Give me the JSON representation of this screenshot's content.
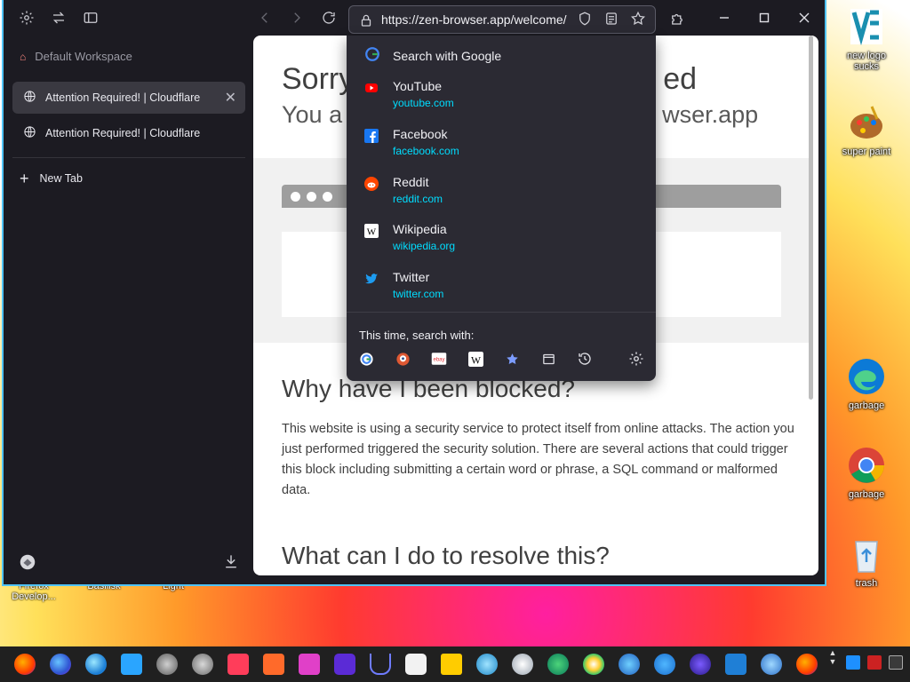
{
  "browser": {
    "url": "https://zen-browser.app/welcome/",
    "workspace": "Default Workspace",
    "tabs": [
      {
        "label": "Attention Required! | Cloudflare",
        "active": true
      },
      {
        "label": "Attention Required! | Cloudflare",
        "active": false
      }
    ],
    "new_tab": "New Tab"
  },
  "page": {
    "h1_partial": "Sorry",
    "h1_tail": "ed",
    "h1b_partial": "You a",
    "h1b_tail": "wser.app",
    "h2": "Why have I been blocked?",
    "para": "This website is using a security service to protect itself from online attacks. The action you just performed triggered the security solution. There are several actions that could trigger this block including submitting a certain word or phrase, a SQL command or malformed data.",
    "h2b": "What can I do to resolve this?"
  },
  "dropdown": {
    "search_with": "Search with Google",
    "suggestions": [
      {
        "title": "YouTube",
        "url": "youtube.com",
        "icon": "youtube-icon",
        "color": "#ff0000"
      },
      {
        "title": "Facebook",
        "url": "facebook.com",
        "icon": "facebook-icon",
        "color": "#1877f2"
      },
      {
        "title": "Reddit",
        "url": "reddit.com",
        "icon": "reddit-icon",
        "color": "#ff4500"
      },
      {
        "title": "Wikipedia",
        "url": "wikipedia.org",
        "icon": "wikipedia-icon",
        "color": "#ffffff"
      },
      {
        "title": "Twitter",
        "url": "twitter.com",
        "icon": "twitter-icon",
        "color": "#1d9bf0"
      }
    ],
    "this_time_label": "This time, search with:",
    "engines": [
      "google-icon",
      "duckduckgo-icon",
      "ebay-icon",
      "wikipedia-icon",
      "bookmarks-star-icon",
      "tabs-icon",
      "history-icon",
      "settings-gear-icon"
    ]
  },
  "desktop": {
    "icons": [
      {
        "label": "new logo sucks"
      },
      {
        "label": "super paint"
      },
      {
        "label": "garbage"
      },
      {
        "label": "garbage"
      },
      {
        "label": "trash"
      }
    ],
    "partial_labels": [
      "Firefox Develop...",
      "Basilisk",
      "Light"
    ]
  },
  "colors": {
    "accent": "#4fc3f7",
    "link": "#00ddff"
  }
}
